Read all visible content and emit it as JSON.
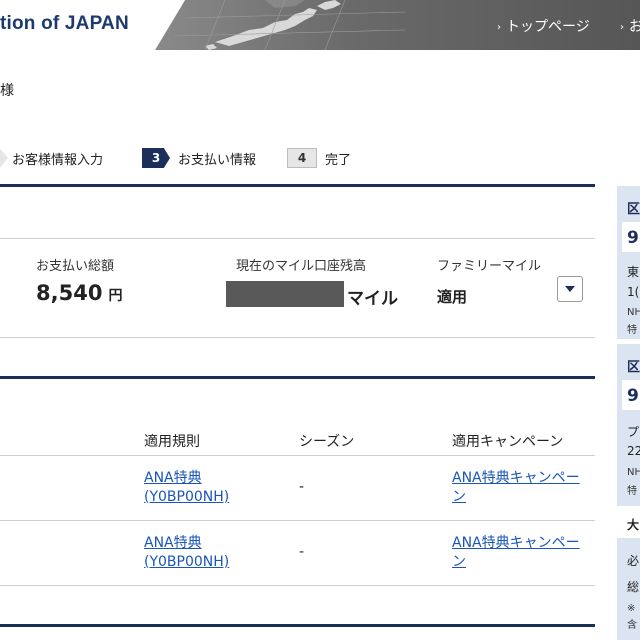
{
  "header": {
    "brand": "tion of JAPAN",
    "nav": [
      {
        "label": "トップページ"
      },
      {
        "label": "お"
      }
    ]
  },
  "customer": {
    "suffix": "様"
  },
  "steps": [
    {
      "label": "お客様情報入力",
      "num": ""
    },
    {
      "label": "お支払い情報",
      "num": "3"
    },
    {
      "label": "完了",
      "num": "4"
    }
  ],
  "payment": {
    "total_label": "お支払い総額",
    "total_value": "8,540",
    "total_unit": "円",
    "balance_label": "現在のマイル口座残高",
    "balance_unit": "マイル",
    "family_label": "ファミリーマイル",
    "family_value": "適用"
  },
  "table": {
    "headers": [
      "適用規則",
      "シーズン",
      "適用キャンペーン"
    ],
    "rows": [
      {
        "rule_line1": "ANA特典",
        "rule_line2": "(Y0BP00NH)",
        "season": "-",
        "campaign_line1": "ANA特典キャンペー",
        "campaign_line2": "ン"
      },
      {
        "rule_line1": "ANA特典",
        "rule_line2": "(Y0BP00NH)",
        "season": "-",
        "campaign_line1": "ANA特典キャンペー",
        "campaign_line2": "ン"
      }
    ]
  },
  "side_panel": {
    "block1_title": "区",
    "block1_value": "9",
    "block1_line1": "東",
    "block1_line2": "1(",
    "block1_line3": "NH",
    "block1_line4": "特",
    "block2_title": "区",
    "block2_value": "9",
    "block2_line1": "プ",
    "block2_line2": "22",
    "block2_line3": "NH",
    "block2_line4": "特",
    "block3_line1": "大",
    "block3_line2": "必",
    "block3_line3": "総",
    "block3_line4": "※",
    "block3_line5": "含"
  },
  "colors": {
    "navy": "#1c2f5a",
    "link": "#1a55b8",
    "panel": "#dbe4f1"
  }
}
